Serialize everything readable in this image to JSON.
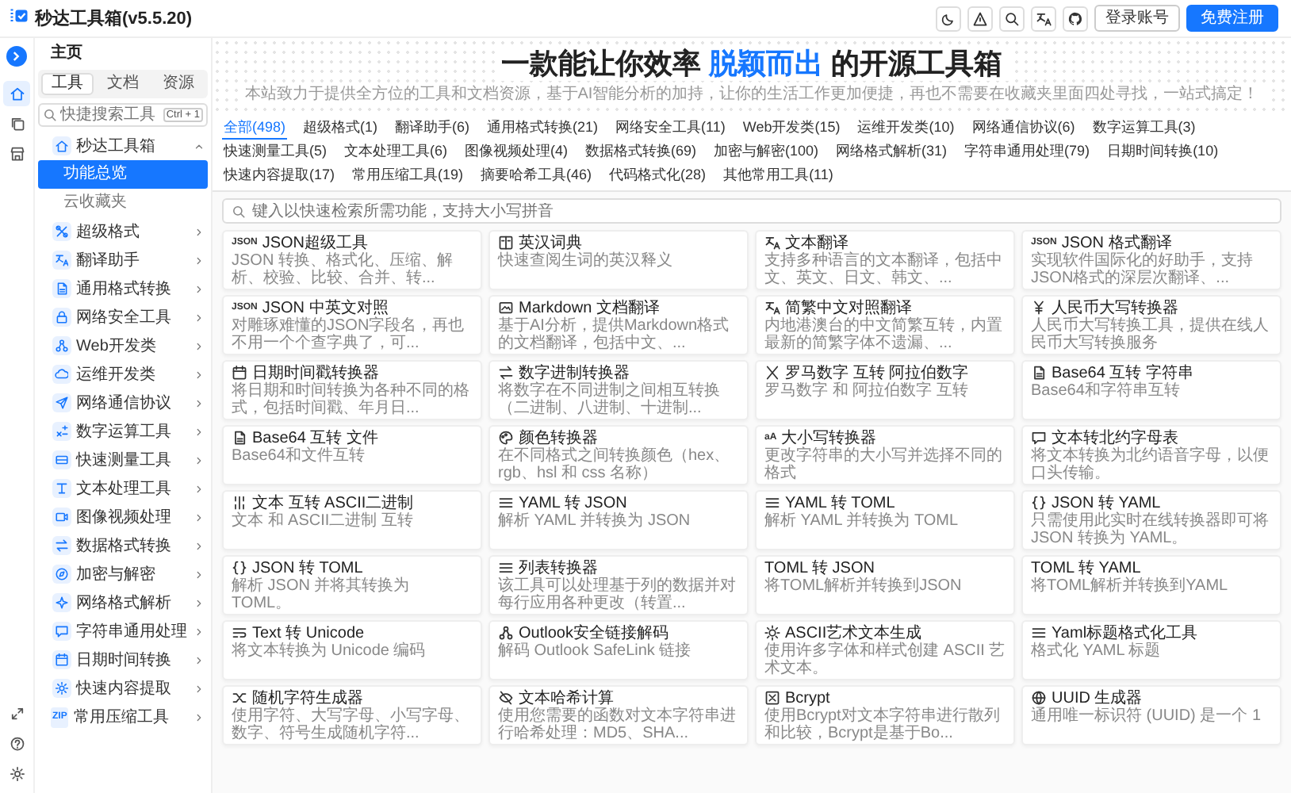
{
  "header": {
    "title": "秒达工具箱(v5.5.20)",
    "login": "登录账号",
    "register": "免费注册"
  },
  "rail": [
    {
      "selected": true
    },
    {
      "selected": false
    },
    {
      "selected": false
    }
  ],
  "nav": {
    "heading": "主页",
    "tabs": [
      {
        "label": "工具",
        "selected": true
      },
      {
        "label": "文档",
        "selected": false
      },
      {
        "label": "资源",
        "selected": false
      }
    ],
    "search": {
      "placeholder": "快捷搜索工具",
      "shortcut": "Ctrl + 1"
    },
    "tree": [
      {
        "label": "秒达工具箱",
        "expanded": true,
        "children": [
          {
            "label": "功能总览",
            "selected": true
          },
          {
            "label": "云收藏夹",
            "selected": false
          }
        ]
      },
      {
        "label": "超级格式",
        "expanded": false
      },
      {
        "label": "翻译助手",
        "expanded": false
      },
      {
        "label": "通用格式转换",
        "expanded": false
      },
      {
        "label": "网络安全工具",
        "expanded": false
      },
      {
        "label": "Web开发类",
        "expanded": false
      },
      {
        "label": "运维开发类",
        "expanded": false
      },
      {
        "label": "网络通信协议",
        "expanded": false
      },
      {
        "label": "数字运算工具",
        "expanded": false
      },
      {
        "label": "快速测量工具",
        "expanded": false
      },
      {
        "label": "文本处理工具",
        "expanded": false
      },
      {
        "label": "图像视频处理",
        "expanded": false
      },
      {
        "label": "数据格式转换",
        "expanded": false
      },
      {
        "label": "加密与解密",
        "expanded": false
      },
      {
        "label": "网络格式解析",
        "expanded": false
      },
      {
        "label": "字符串通用处理",
        "expanded": false
      },
      {
        "label": "日期时间转换",
        "expanded": false
      },
      {
        "label": "快速内容提取",
        "expanded": false
      },
      {
        "label": "常用压缩工具",
        "badge": "ZIP",
        "expanded": false
      }
    ]
  },
  "hero": {
    "title_before": "一款能让你效率 ",
    "title_highlight": "脱颖而出",
    "title_after": " 的开源工具箱",
    "subtitle": "本站致力于提供全方位的工具和文档资源，基于AI智能分析的加持，让你的生活工作更加便捷，再也不需要在收藏夹里面四处寻找，一站式搞定！"
  },
  "filters": [
    {
      "label": "全部(498)",
      "selected": true
    },
    {
      "label": "超级格式(1)",
      "selected": false
    },
    {
      "label": "翻译助手(6)",
      "selected": false
    },
    {
      "label": "通用格式转换(21)",
      "selected": false
    },
    {
      "label": "网络安全工具(11)",
      "selected": false
    },
    {
      "label": "Web开发类(15)",
      "selected": false
    },
    {
      "label": "运维开发类(10)",
      "selected": false
    },
    {
      "label": "网络通信协议(6)",
      "selected": false
    },
    {
      "label": "数字运算工具(3)",
      "selected": false
    },
    {
      "label": "快速测量工具(5)",
      "selected": false
    },
    {
      "label": "文本处理工具(6)",
      "selected": false
    },
    {
      "label": "图像视频处理(4)",
      "selected": false
    },
    {
      "label": "数据格式转换(69)",
      "selected": false
    },
    {
      "label": "加密与解密(100)",
      "selected": false
    },
    {
      "label": "网络格式解析(31)",
      "selected": false
    },
    {
      "label": "字符串通用处理(79)",
      "selected": false
    },
    {
      "label": "日期时间转换(10)",
      "selected": false
    },
    {
      "label": "快速内容提取(17)",
      "selected": false
    },
    {
      "label": "常用压缩工具(19)",
      "selected": false
    },
    {
      "label": "摘要哈希工具(46)",
      "selected": false
    },
    {
      "label": "代码格式化(28)",
      "selected": false
    },
    {
      "label": "其他常用工具(11)",
      "selected": false
    }
  ],
  "search": {
    "placeholder": "键入以快速检索所需功能，支持大小写拼音"
  },
  "cards": [
    {
      "badge": "JSON",
      "title": "JSON超级工具",
      "desc": "JSON 转换、格式化、压缩、解析、校验、比较、合并、转..."
    },
    {
      "title": "英汉词典",
      "desc": "快速查阅生词的英汉释义"
    },
    {
      "title": "文本翻译",
      "desc": "支持多种语言的文本翻译，包括中文、英文、日文、韩文、..."
    },
    {
      "badge": "JSON",
      "title": "JSON 格式翻译",
      "desc": "实现软件国际化的好助手，支持JSON格式的深层次翻译、..."
    },
    {
      "badge": "JSON",
      "title": "JSON 中英文对照",
      "desc": "对雕琢难懂的JSON字段名，再也不用一个个查字典了，可..."
    },
    {
      "title": "Markdown 文档翻译",
      "desc": "基于AI分析，提供Markdown格式的文档翻译，包括中文、..."
    },
    {
      "title": "简繁中文对照翻译",
      "desc": "内地港澳台的中文简繁互转，内置最新的简繁字体不遗漏、..."
    },
    {
      "title": "人民币大写转换器",
      "desc": "人民币大写转换工具，提供在线人民币大写转换服务"
    },
    {
      "title": "日期时间戳转换器",
      "desc": "将日期和时间转换为各种不同的格式，包括时间戳、年月日..."
    },
    {
      "title": "数字进制转换器",
      "desc": "将数字在不同进制之间相互转换（二进制、八进制、十进制..."
    },
    {
      "title": "罗马数字 互转 阿拉伯数字",
      "desc": "罗马数字 和 阿拉伯数字 互转"
    },
    {
      "title": "Base64 互转 字符串",
      "desc": "Base64和字符串互转"
    },
    {
      "title": "Base64 互转 文件",
      "desc": "Base64和文件互转"
    },
    {
      "title": "颜色转换器",
      "desc": "在不同格式之间转换颜色（hex、rgb、hsl 和 css 名称）"
    },
    {
      "badge": "aA",
      "title": "大小写转换器",
      "desc": "更改字符串的大小写并选择不同的格式"
    },
    {
      "title": "文本转北约字母表",
      "desc": "将文本转换为北约语音字母，以便口头传输。"
    },
    {
      "title": "文本 互转 ASCII二进制",
      "desc": "文本 和 ASCII二进制 互转"
    },
    {
      "title": "YAML 转 JSON",
      "desc": "解析 YAML 并转换为 JSON"
    },
    {
      "title": "YAML 转 TOML",
      "desc": "解析 YAML 并转换为 TOML"
    },
    {
      "title": "JSON 转 YAML",
      "desc": "只需使用此实时在线转换器即可将 JSON 转换为 YAML。"
    },
    {
      "title": "JSON 转 TOML",
      "desc": "解析 JSON 并将其转换为 TOML。"
    },
    {
      "title": "列表转换器",
      "desc": "该工具可以处理基于列的数据并对每行应用各种更改（转置..."
    },
    {
      "title": "TOML 转 JSON",
      "desc": "将TOML解析并转换到JSON"
    },
    {
      "title": "TOML 转 YAML",
      "desc": "将TOML解析并转换到YAML"
    },
    {
      "title": "Text 转 Unicode",
      "desc": "将文本转换为 Unicode 编码"
    },
    {
      "title": "Outlook安全链接解码",
      "desc": "解码 Outlook SafeLink 链接"
    },
    {
      "title": "ASCII艺术文本生成",
      "desc": "使用许多字体和样式创建 ASCII 艺术文本。"
    },
    {
      "title": "Yaml标题格式化工具",
      "desc": "格式化 YAML 标题"
    },
    {
      "title": "随机字符生成器",
      "desc": "使用字符、大写字母、小写字母、数字、符号生成随机字符..."
    },
    {
      "title": "文本哈希计算",
      "desc": "使用您需要的函数对文本字符串进行哈希处理：MD5、SHA..."
    },
    {
      "title": "Bcrypt",
      "desc": "使用Bcrypt对文本字符串进行散列和比较，Bcrypt是基于Bo..."
    },
    {
      "title": "UUID 生成器",
      "desc": "通用唯一标识符 (UUID) 是一个 1"
    }
  ]
}
